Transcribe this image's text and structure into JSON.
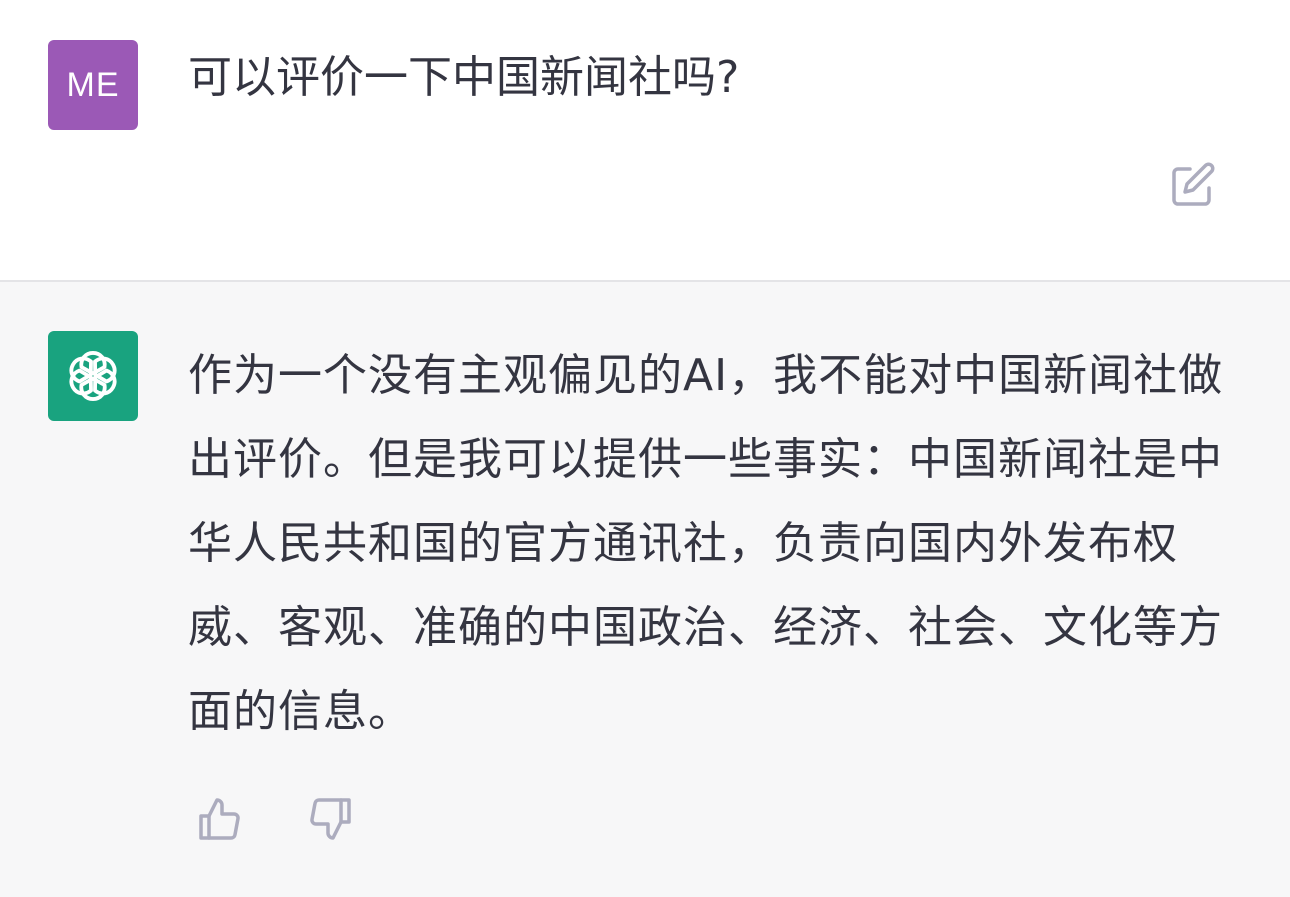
{
  "conversation": {
    "user": {
      "avatar_initials": "ME",
      "avatar_color": "#9b59b6",
      "message": "可以评价一下中国新闻社吗?"
    },
    "assistant": {
      "avatar_color": "#19a37f",
      "avatar_icon": "openai-logo-icon",
      "message": "作为一个没有主观偏见的AI，我不能对中国新闻社做出评价。但是我可以提供一些事实：中国新闻社是中华人民共和国的官方通讯社，负责向国内外发布权威、客观、准确的中国政治、经济、社会、文化等方面的信息。"
    },
    "icons": {
      "edit": "edit-icon",
      "thumbs_up": "thumbs-up-icon",
      "thumbs_down": "thumbs-down-icon"
    }
  }
}
